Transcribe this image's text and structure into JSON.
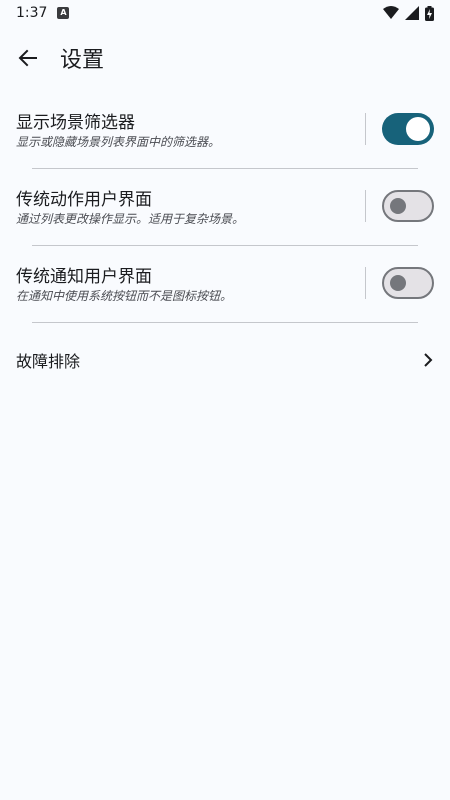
{
  "status_bar": {
    "time": "1:37",
    "notification_icon": "a-notification-icon",
    "icons": [
      "wifi-icon",
      "signal-icon",
      "battery-charging-icon"
    ]
  },
  "header": {
    "back_icon": "arrow-back-icon",
    "title": "设置"
  },
  "settings": [
    {
      "title": "显示场景筛选器",
      "description": "显示或隐藏场景列表界面中的筛选器。",
      "enabled": true
    },
    {
      "title": "传统动作用户界面",
      "description": "通过列表更改操作显示。适用于复杂场景。",
      "enabled": false
    },
    {
      "title": "传统通知用户界面",
      "description": "在通知中使用系统按钮而不是图标按钮。",
      "enabled": false
    }
  ],
  "troubleshoot": {
    "label": "故障排除",
    "icon": "chevron-right-icon"
  },
  "colors": {
    "background": "#f9fbfe",
    "switch_on": "#17627a",
    "switch_off_track": "#e4e2e6",
    "switch_off_outline": "#75777c",
    "divider": "#c5c7cc"
  }
}
